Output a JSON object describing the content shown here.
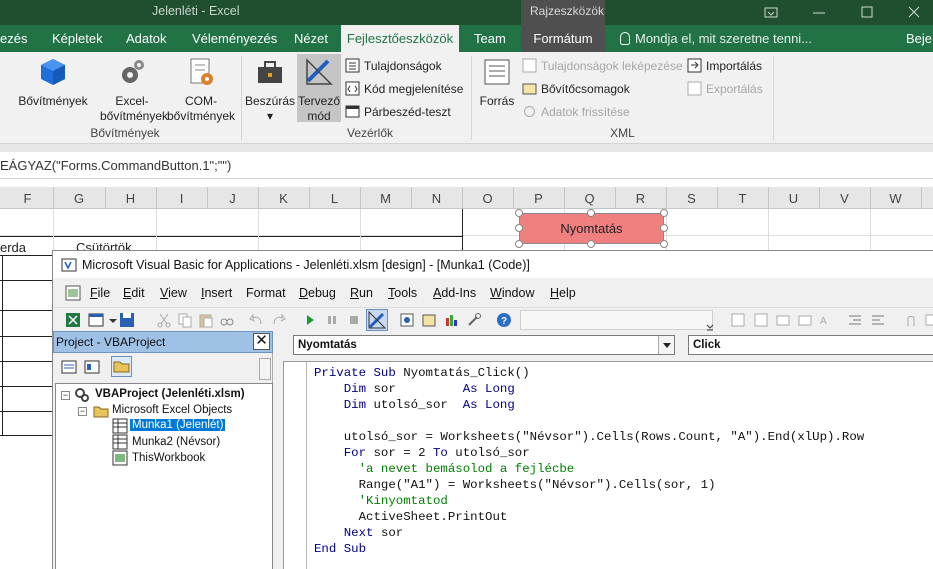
{
  "excel": {
    "window_title": "Jelenléti - Excel",
    "context_tab_group": "Rajzeszközök",
    "tabs": [
      "ezés",
      "Képletek",
      "Adatok",
      "Véleményezés",
      "Nézet",
      "Fejlesztőeszközök",
      "Team",
      "Formátum"
    ],
    "tab_right_cut": "Beje",
    "active_tab": "Fejlesztőeszközök",
    "tell_me": "Mondja el, mit szeretne tenni...",
    "ribbon": {
      "bovitmenyek": {
        "b1": "Bővítmények",
        "b2a": "Excel-",
        "b2b": "bővítmények",
        "b3a": "COM-",
        "b3b": "bővítmények",
        "group": "Bővítmények"
      },
      "vezerlok": {
        "insert_a": "Beszúrás",
        "insert_b": "▾",
        "design_a": "Tervező",
        "design_b": "mód",
        "props": "Tulajdonságok",
        "view_code": "Kód megjelenítése",
        "dialog": "Párbeszéd-teszt",
        "group": "Vezérlők"
      },
      "xml": {
        "source": "Forrás",
        "map_props": "Tulajdonságok leképezése",
        "expansion": "Bővítőcsomagok",
        "refresh": "Adatok frissítése",
        "import": "Importálás",
        "export": "Exportálás",
        "group": "XML"
      }
    },
    "formula": "EÁGYAZ(\"Forms.CommandButton.1\";\"\")",
    "columns": [
      "F",
      "G",
      "H",
      "I",
      "J",
      "K",
      "L",
      "M",
      "N",
      "O",
      "P",
      "Q",
      "R",
      "S",
      "T",
      "U",
      "V",
      "W"
    ],
    "cells": {
      "wed": "erda",
      "thu": "Csütörtök"
    },
    "print_button": "Nyomtatás"
  },
  "vba": {
    "title": "Microsoft Visual Basic for Applications - Jelenléti.xlsm [design] - [Munka1 (Code)]",
    "menu": [
      {
        "u": "F",
        "rest": "ile"
      },
      {
        "u": "E",
        "rest": "dit"
      },
      {
        "u": "V",
        "rest": "iew"
      },
      {
        "u": "I",
        "rest": "nsert"
      },
      {
        "u": "",
        "rest": "Format"
      },
      {
        "u": "D",
        "rest": "ebug"
      },
      {
        "u": "R",
        "rest": "un"
      },
      {
        "u": "T",
        "rest": "ools"
      },
      {
        "u": "A",
        "rest": "dd-Ins"
      },
      {
        "u": "W",
        "rest": "indow"
      },
      {
        "u": "H",
        "rest": "elp"
      }
    ],
    "project_title": "Project - VBAProject",
    "tree": {
      "root": "VBAProject (Jelenléti.xlsm)",
      "folder": "Microsoft Excel Objects",
      "sheet1": "Munka1 (Jelenlét)",
      "sheet2": "Munka2 (Névsor)",
      "wb": "ThisWorkbook"
    },
    "object_combo": "Nyomtatás",
    "proc_combo": "Click",
    "code_lines": [
      "Private Sub Nyomtatás_Click()",
      "    Dim sor         As Long",
      "    Dim utolsó_sor  As Long",
      "",
      "    utolsó_sor = Worksheets(\"Névsor\").Cells(Rows.Count, \"A\").End(xlUp).Row",
      "    For sor = 2 To utolsó_sor",
      "      'a nevet bemásolod a fejlécbe",
      "      Range(\"A1\") = Worksheets(\"Névsor\").Cells(sor, 1)",
      "      'Kinyomtatod",
      "      ActiveSheet.PrintOut",
      "    Next sor",
      "End Sub"
    ]
  }
}
